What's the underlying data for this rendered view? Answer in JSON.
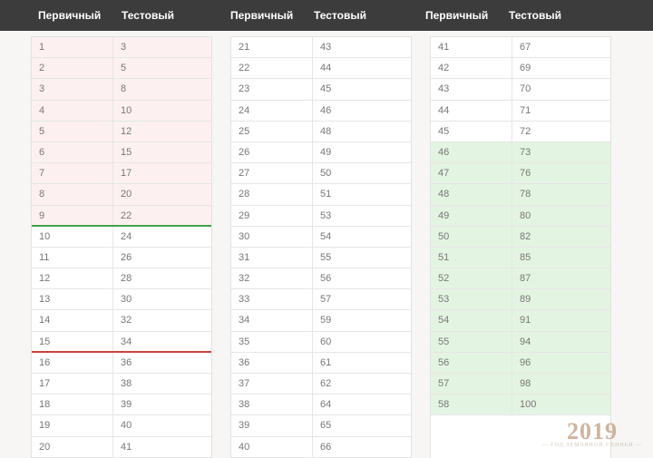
{
  "headers": {
    "col1": "Первичный",
    "col2": "Тестовый"
  },
  "chart_data": {
    "type": "table",
    "columns": [
      "Первичный",
      "Тестовый"
    ],
    "tables": [
      {
        "rows": [
          {
            "p": "1",
            "t": "3",
            "tint": "red"
          },
          {
            "p": "2",
            "t": "5",
            "tint": "red"
          },
          {
            "p": "3",
            "t": "8",
            "tint": "red"
          },
          {
            "p": "4",
            "t": "10",
            "tint": "red"
          },
          {
            "p": "5",
            "t": "12",
            "tint": "red"
          },
          {
            "p": "6",
            "t": "15",
            "tint": "red"
          },
          {
            "p": "7",
            "t": "17",
            "tint": "red"
          },
          {
            "p": "8",
            "t": "20",
            "tint": "red"
          },
          {
            "p": "9",
            "t": "22",
            "tint": "red",
            "sep": "green"
          },
          {
            "p": "10",
            "t": "24"
          },
          {
            "p": "11",
            "t": "26"
          },
          {
            "p": "12",
            "t": "28"
          },
          {
            "p": "13",
            "t": "30"
          },
          {
            "p": "14",
            "t": "32"
          },
          {
            "p": "15",
            "t": "34",
            "sep": "red"
          },
          {
            "p": "16",
            "t": "36"
          },
          {
            "p": "17",
            "t": "38"
          },
          {
            "p": "18",
            "t": "39"
          },
          {
            "p": "19",
            "t": "40"
          },
          {
            "p": "20",
            "t": "41"
          }
        ]
      },
      {
        "rows": [
          {
            "p": "21",
            "t": "43"
          },
          {
            "p": "22",
            "t": "44"
          },
          {
            "p": "23",
            "t": "45"
          },
          {
            "p": "24",
            "t": "46"
          },
          {
            "p": "25",
            "t": "48"
          },
          {
            "p": "26",
            "t": "49"
          },
          {
            "p": "27",
            "t": "50"
          },
          {
            "p": "28",
            "t": "51"
          },
          {
            "p": "29",
            "t": "53"
          },
          {
            "p": "30",
            "t": "54"
          },
          {
            "p": "31",
            "t": "55"
          },
          {
            "p": "32",
            "t": "56"
          },
          {
            "p": "33",
            "t": "57"
          },
          {
            "p": "34",
            "t": "59"
          },
          {
            "p": "35",
            "t": "60"
          },
          {
            "p": "36",
            "t": "61"
          },
          {
            "p": "37",
            "t": "62"
          },
          {
            "p": "38",
            "t": "64"
          },
          {
            "p": "39",
            "t": "65"
          },
          {
            "p": "40",
            "t": "66"
          }
        ]
      },
      {
        "rows": [
          {
            "p": "41",
            "t": "67"
          },
          {
            "p": "42",
            "t": "69"
          },
          {
            "p": "43",
            "t": "70"
          },
          {
            "p": "44",
            "t": "71"
          },
          {
            "p": "45",
            "t": "72"
          },
          {
            "p": "46",
            "t": "73",
            "tint": "green"
          },
          {
            "p": "47",
            "t": "76",
            "tint": "green"
          },
          {
            "p": "48",
            "t": "78",
            "tint": "green"
          },
          {
            "p": "49",
            "t": "80",
            "tint": "green"
          },
          {
            "p": "50",
            "t": "82",
            "tint": "green"
          },
          {
            "p": "51",
            "t": "85",
            "tint": "green"
          },
          {
            "p": "52",
            "t": "87",
            "tint": "green"
          },
          {
            "p": "53",
            "t": "89",
            "tint": "green"
          },
          {
            "p": "54",
            "t": "91",
            "tint": "green"
          },
          {
            "p": "55",
            "t": "94",
            "tint": "green"
          },
          {
            "p": "56",
            "t": "96",
            "tint": "green"
          },
          {
            "p": "57",
            "t": "98",
            "tint": "green"
          },
          {
            "p": "58",
            "t": "100",
            "tint": "green"
          }
        ]
      }
    ]
  },
  "watermark": {
    "year": "2019",
    "sub": "— ГОД ЗЕМЛЯНОЙ СВИНЬИ —"
  }
}
